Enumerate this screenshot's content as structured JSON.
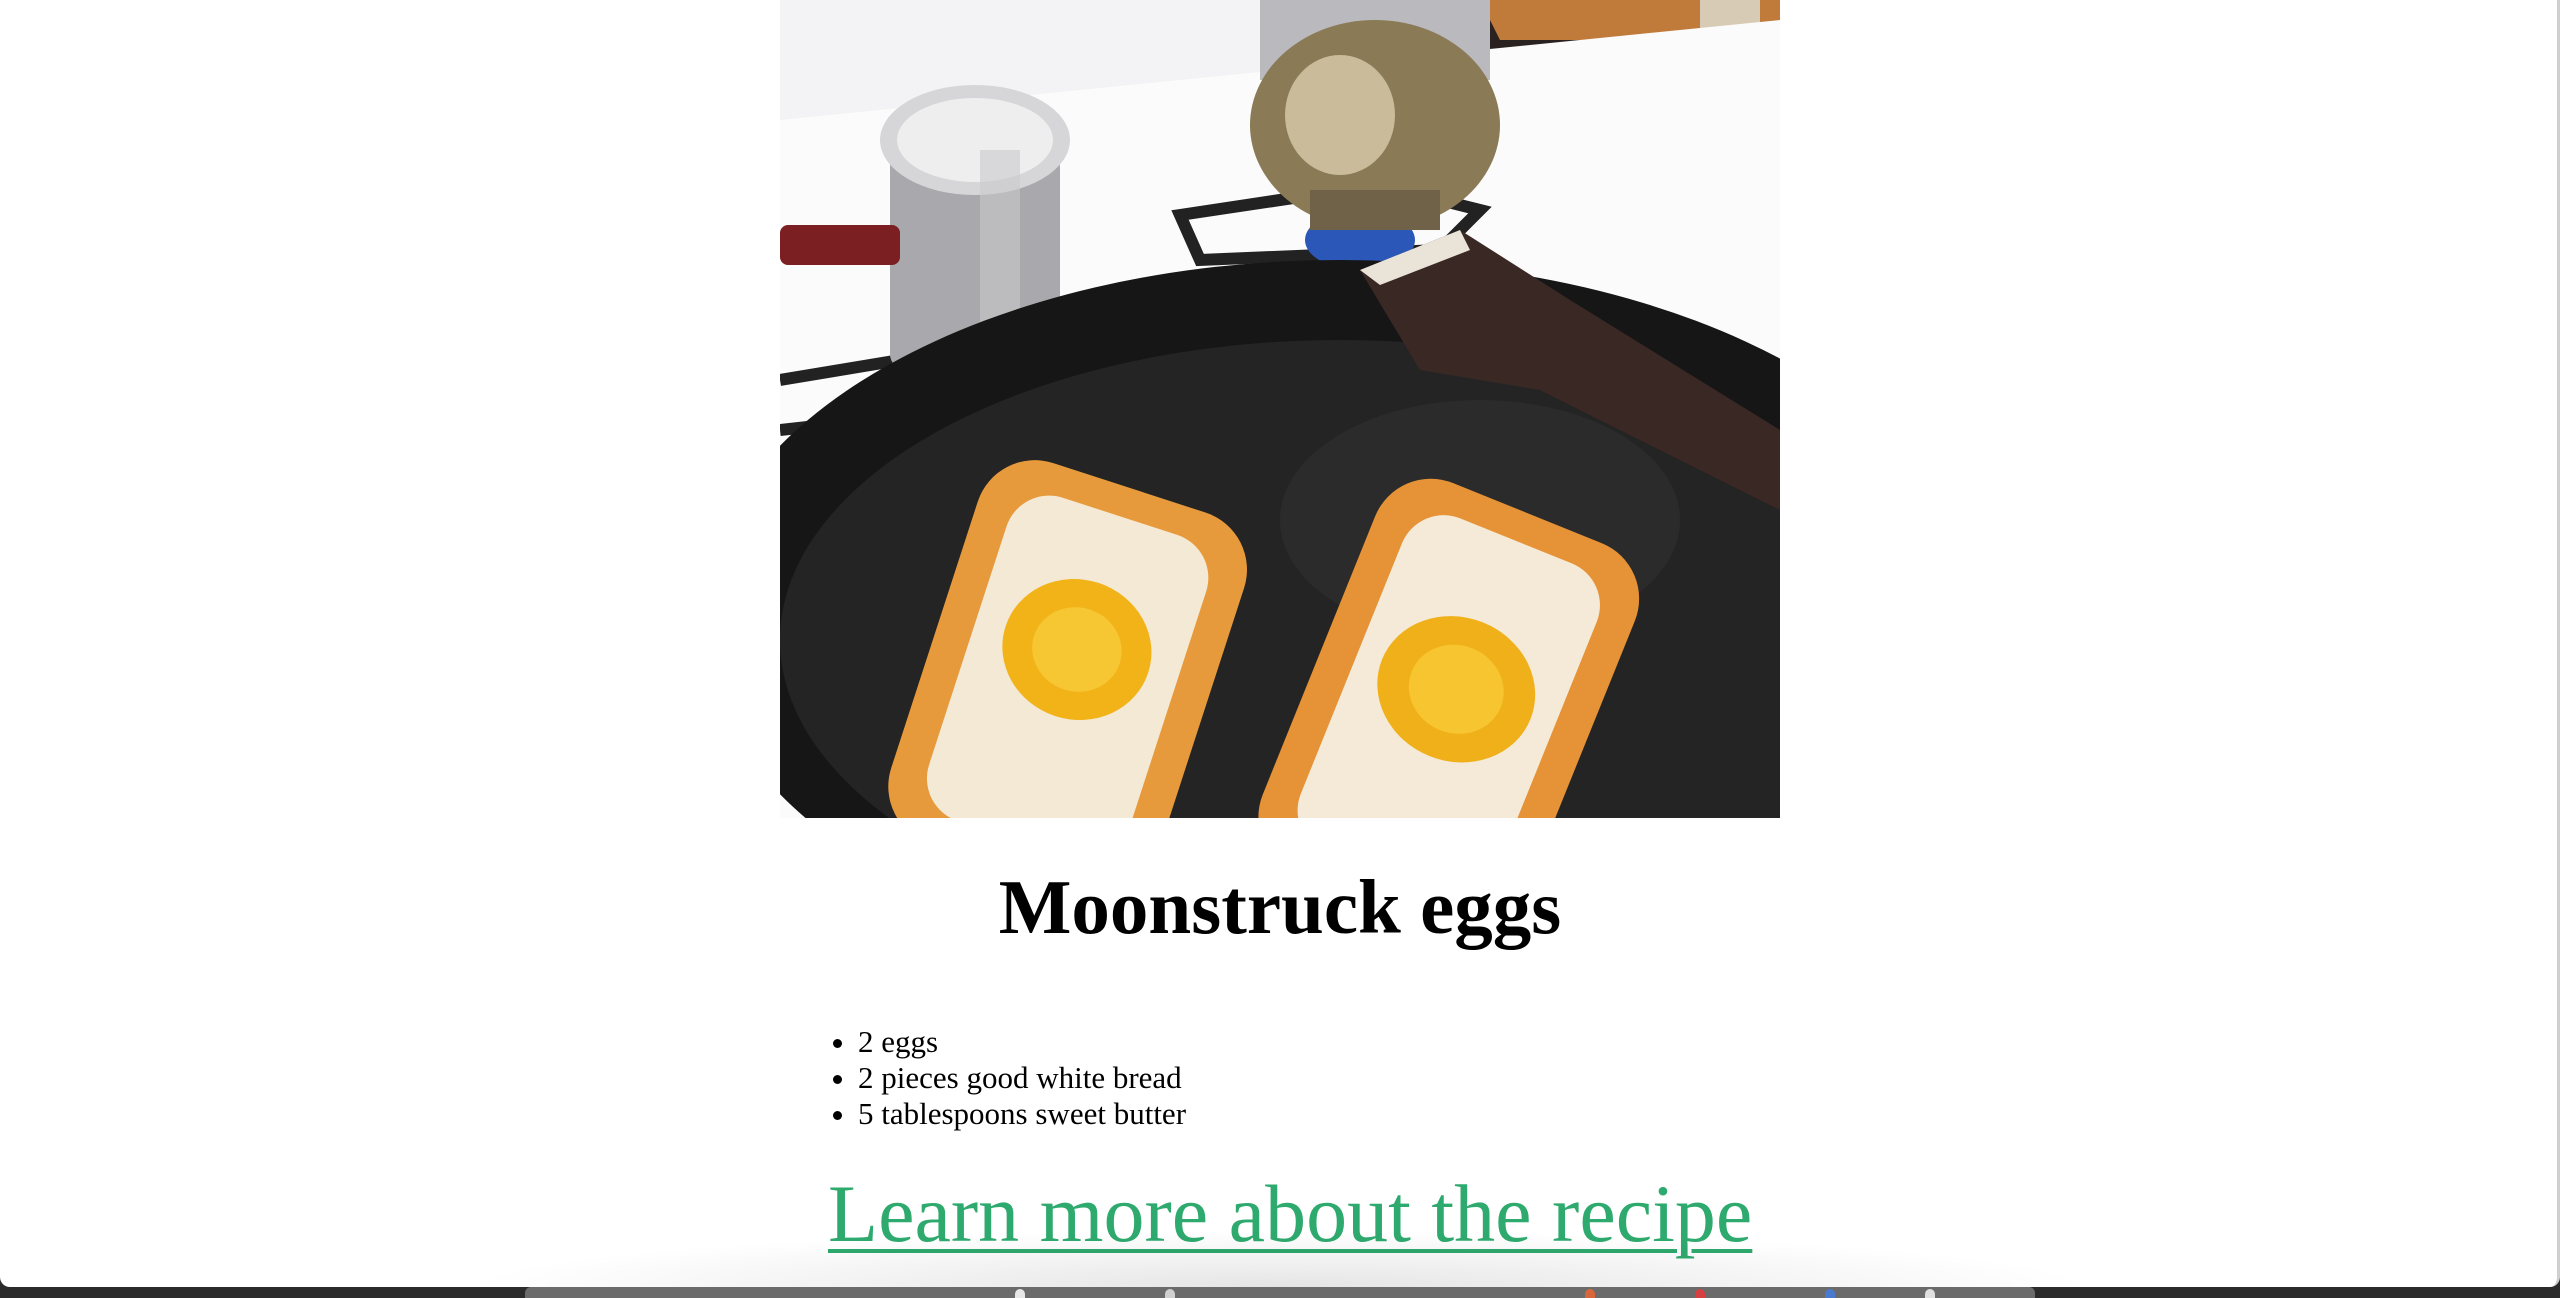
{
  "recipe": {
    "title": "Moonstruck eggs",
    "image_alt": "Eggs cooked in bread in a cast-iron skillet",
    "ingredients": [
      "2 eggs",
      "2 pieces good white bread",
      "5 tablespoons sweet butter"
    ],
    "link_label": "Learn more about the recipe"
  },
  "colors": {
    "link": "#2eaa6e",
    "page_background": "#ffffff"
  }
}
